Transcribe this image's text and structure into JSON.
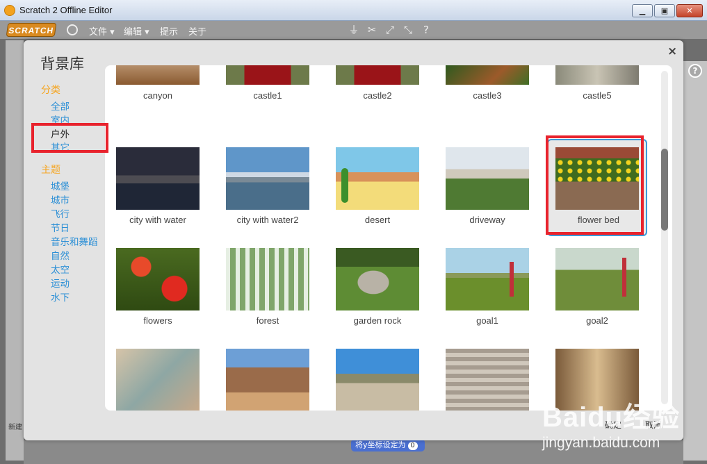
{
  "window": {
    "title": "Scratch 2 Offline Editor"
  },
  "menubar": {
    "logo": "SCRATCH",
    "items": [
      "文件 ▾",
      "编辑 ▾",
      "提示",
      "关于"
    ]
  },
  "dialog": {
    "title": "背景库",
    "close": "×",
    "ok_label": "确定",
    "cancel_label": "取消"
  },
  "sidebar": {
    "category_header": "分类",
    "categories": [
      "全部",
      "室内",
      "户外",
      "其它"
    ],
    "selected_category": "户外",
    "theme_header": "主题",
    "themes": [
      "城堡",
      "城市",
      "飞行",
      "节日",
      "音乐和舞蹈",
      "自然",
      "太空",
      "运动",
      "水下"
    ]
  },
  "library": {
    "items": [
      "canyon",
      "castle1",
      "castle2",
      "castle3",
      "castle5",
      "city with water",
      "city with water2",
      "desert",
      "driveway",
      "flower bed",
      "flowers",
      "forest",
      "garden rock",
      "goal1",
      "goal2",
      "",
      "",
      "",
      "",
      ""
    ],
    "selected_item": "flower bed"
  },
  "background": {
    "block_label": "将y坐标设定为",
    "block_value": "0",
    "side_label": "新建"
  },
  "watermark": {
    "brand": "Baidu经验",
    "url": "jingyan.baidu.com"
  },
  "colors": {
    "accent": "#2b8fd6",
    "category_header": "#f5a623",
    "highlight": "#e8232d",
    "selection": "#3a9ad9"
  }
}
